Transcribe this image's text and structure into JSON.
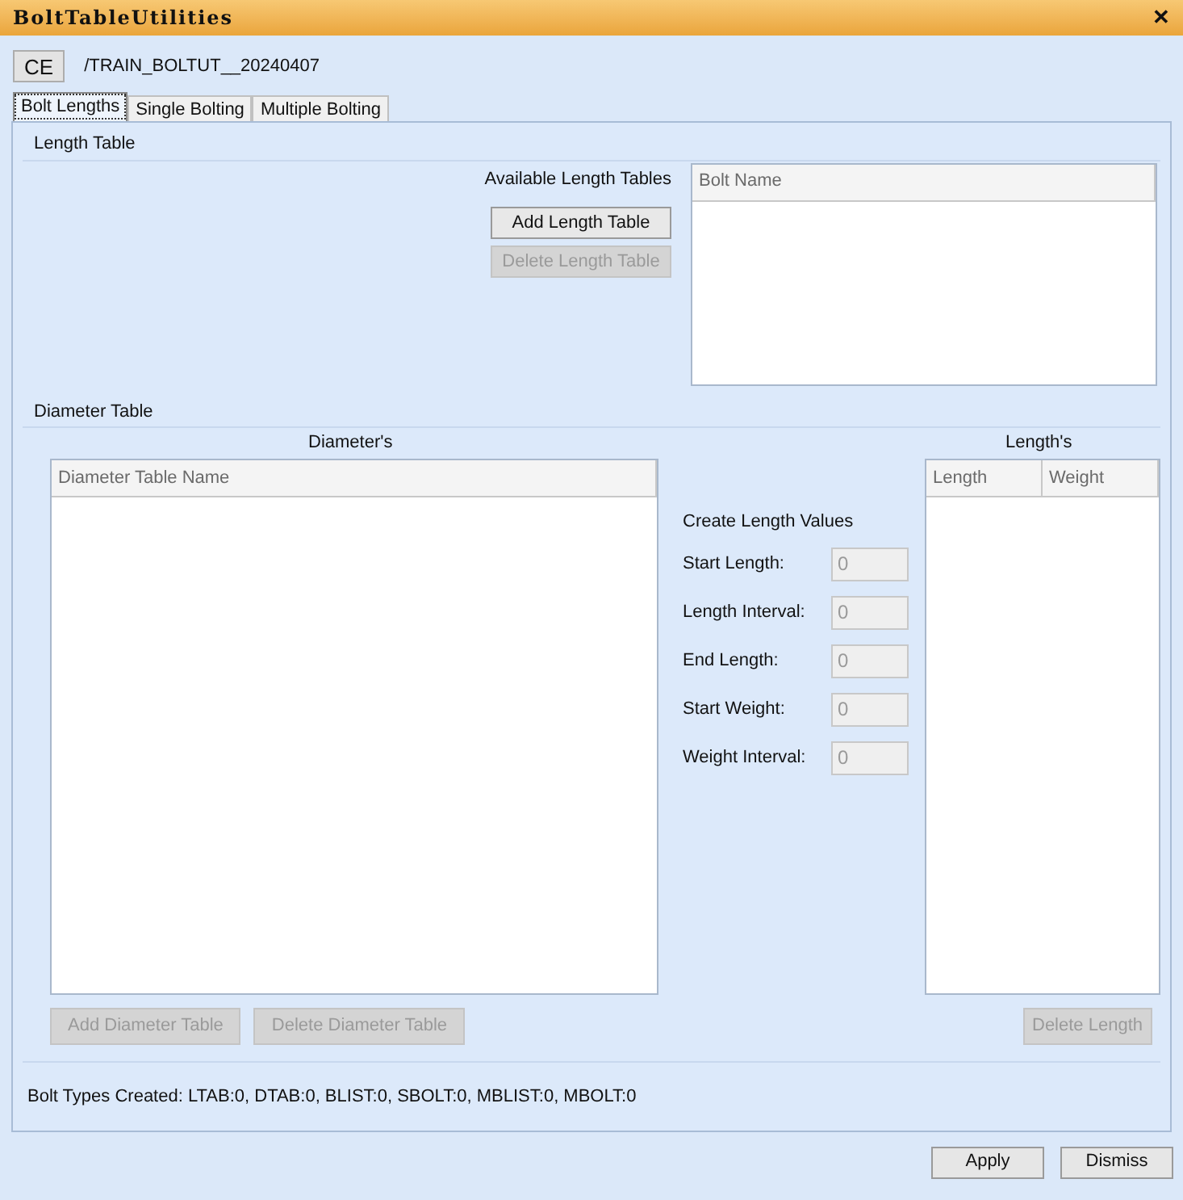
{
  "window": {
    "title": "BoltTableUtilities",
    "close": "✕"
  },
  "header": {
    "ce_button": "CE",
    "path": "/TRAIN_BOLTUT__20240407"
  },
  "tabs": [
    {
      "label": "Bolt Lengths",
      "selected": true
    },
    {
      "label": "Single Bolting",
      "selected": false
    },
    {
      "label": "Multiple Bolting",
      "selected": false
    }
  ],
  "length_table": {
    "title": "Length Table",
    "label": "Available Length Tables",
    "buttons": [
      {
        "label": "Add Length Table",
        "disabled": false
      },
      {
        "label": "Delete Length Table",
        "disabled": true
      }
    ],
    "list": {
      "columns": [
        "Bolt Name"
      ]
    }
  },
  "diameter_table": {
    "title": "Diameter Table",
    "diameters_heading": "Diameter's",
    "lengths_heading": "Length's",
    "diameter_list": {
      "columns": [
        "Diameter Table Name"
      ]
    },
    "create_heading": "Create Length Values",
    "fields": [
      {
        "label": "Start Length:",
        "value": "0"
      },
      {
        "label": "Length Interval:",
        "value": "0"
      },
      {
        "label": "End Length:",
        "value": "0"
      },
      {
        "label": "Start Weight:",
        "value": "0"
      },
      {
        "label": "Weight Interval:",
        "value": "0"
      }
    ],
    "length_list": {
      "columns": [
        "Length",
        "Weight"
      ]
    },
    "buttons": [
      {
        "label": "Add Diameter Table",
        "disabled": true
      },
      {
        "label": "Delete Diameter Table",
        "disabled": true
      }
    ],
    "length_buttons": [
      {
        "label": "Delete Length",
        "disabled": true
      }
    ]
  },
  "status": "Bolt Types Created: LTAB:0, DTAB:0, BLIST:0, SBOLT:0, MBLIST:0, MBOLT:0",
  "footer_buttons": [
    {
      "label": "Apply",
      "disabled": false
    },
    {
      "label": "Dismiss",
      "disabled": false
    }
  ]
}
